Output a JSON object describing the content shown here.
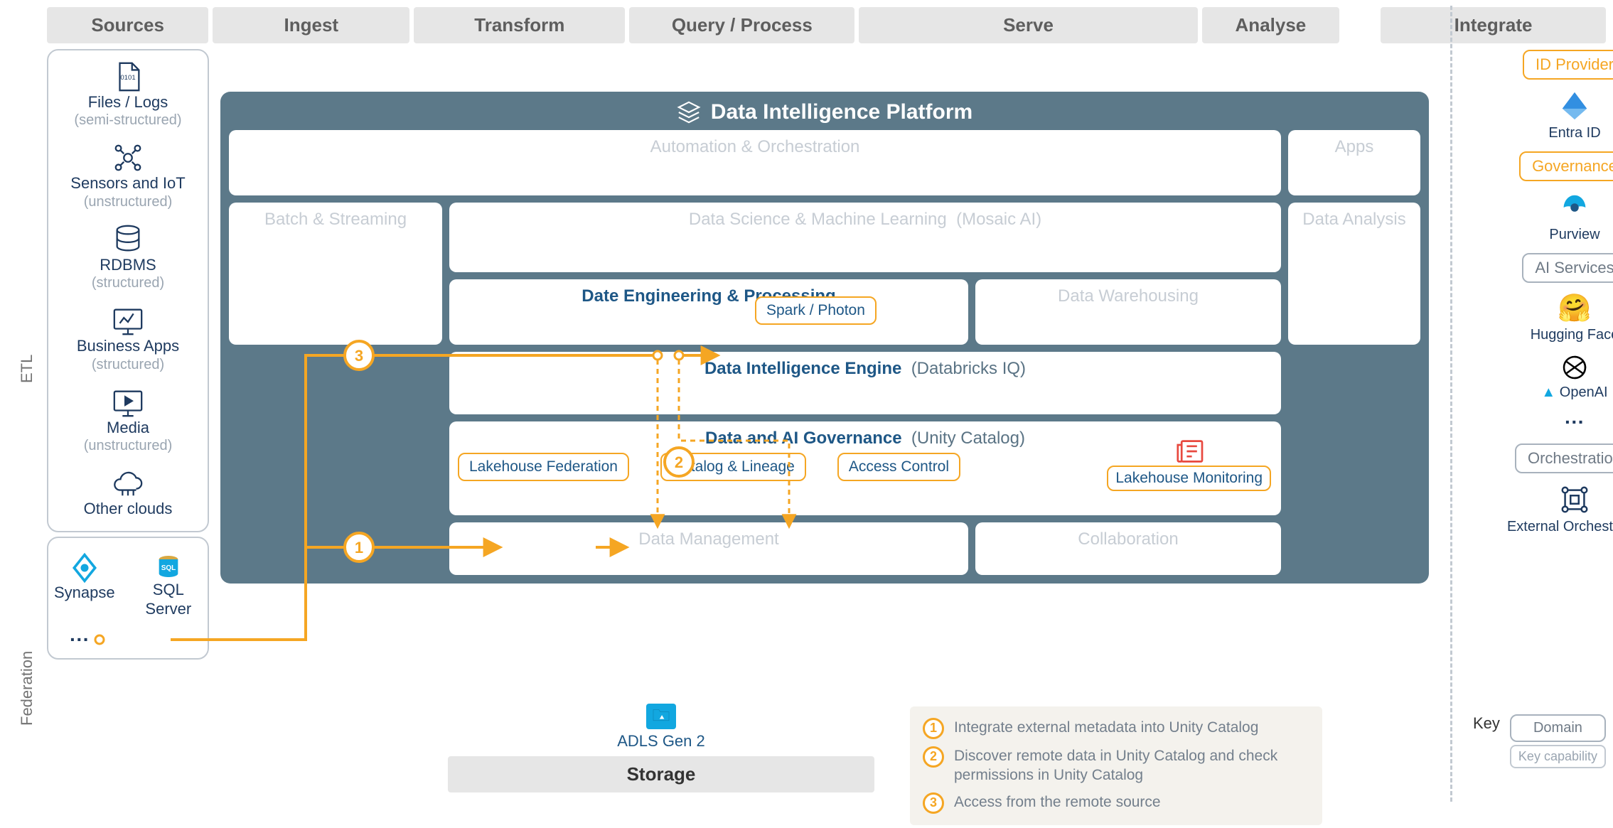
{
  "headers": {
    "sources": "Sources",
    "ingest": "Ingest",
    "transform": "Transform",
    "query": "Query / Process",
    "serve": "Serve",
    "analyse": "Analyse",
    "integrate": "Integrate"
  },
  "side": {
    "etl": "ETL",
    "federation": "Federation"
  },
  "sources": {
    "items": [
      {
        "label": "Files / Logs",
        "sub": "(semi-structured)",
        "icon": "file"
      },
      {
        "label": "Sensors and IoT",
        "sub": "(unstructured)",
        "icon": "iot"
      },
      {
        "label": "RDBMS",
        "sub": "(structured)",
        "icon": "db"
      },
      {
        "label": "Business Apps",
        "sub": "(structured)",
        "icon": "dashboard"
      },
      {
        "label": "Media",
        "sub": "(unstructured)",
        "icon": "play"
      },
      {
        "label": "Other clouds",
        "sub": "",
        "icon": "cloud"
      }
    ],
    "federation": {
      "left": {
        "label": "Synapse",
        "icon": "synapse"
      },
      "right": {
        "label": "SQL Server",
        "icon": "sql"
      }
    }
  },
  "platform": {
    "title": "Data Intelligence Platform",
    "automation": "Automation & Orchestration",
    "apps": "Apps",
    "batch": "Batch & Streaming",
    "ml_prefix": "Data Science & Machine Learning",
    "ml_suffix": "(Mosaic AI)",
    "analysis": "Data Analysis",
    "eng_title": "Date Engineering & Processing",
    "spark": "Spark / Photon",
    "warehouse": "Data Warehousing",
    "intel_prefix": "Data Intelligence Engine",
    "intel_suffix": "(Databricks IQ)",
    "gov_prefix": "Data and AI Governance",
    "gov_suffix": "(Unity Catalog)",
    "gov_chips": {
      "lakefed": "Lakehouse Federation",
      "catalog": "Catalog & Lineage",
      "access": "Access Control",
      "monitor": "Lakehouse Monitoring"
    },
    "mgmt": "Data Management",
    "collab": "Collaboration"
  },
  "storage": {
    "adls": "ADLS Gen 2",
    "band": "Storage"
  },
  "legend": {
    "n1": "1",
    "t1": "Integrate external metadata into Unity Catalog",
    "n2": "2",
    "t2": "Discover remote data in Unity Catalog and check permissions in Unity Catalog",
    "n3": "3",
    "t3": "Access from the remote source"
  },
  "integrate": {
    "id_provider": "ID Provider",
    "entra": "Entra ID",
    "governance": "Governance",
    "purview": "Purview",
    "ai_services": "AI Services",
    "hf": "Hugging Face",
    "openai": "OpenAI",
    "orchestration": "Orchestration",
    "ext_orch": "External Orchestrator"
  },
  "key": {
    "label": "Key",
    "domain": "Domain",
    "capability": "Key capability"
  }
}
